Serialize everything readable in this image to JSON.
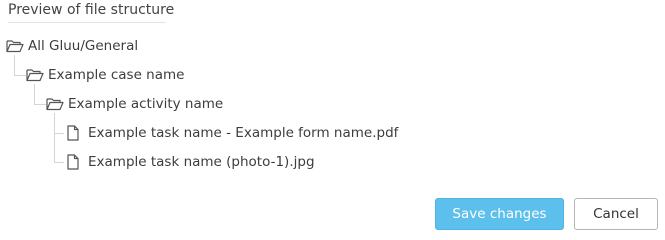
{
  "section": {
    "title": "Preview of file structure"
  },
  "tree": [
    {
      "type": "folder",
      "icon": "folder-open-icon",
      "label": "All Gluu/General"
    },
    {
      "type": "folder",
      "icon": "folder-open-icon",
      "label": "Example case name"
    },
    {
      "type": "folder",
      "icon": "folder-open-icon",
      "label": "Example activity name"
    },
    {
      "type": "file",
      "icon": "file-icon",
      "label": "Example task name - Example form name.pdf"
    },
    {
      "type": "file",
      "icon": "file-icon",
      "label": "Example task name (photo-1).jpg"
    }
  ],
  "actions": {
    "save_label": "Save changes",
    "cancel_label": "Cancel"
  },
  "colors": {
    "primary": "#5dc0ec",
    "text": "#3d3d3d",
    "tree_line": "#d5d5d5"
  }
}
